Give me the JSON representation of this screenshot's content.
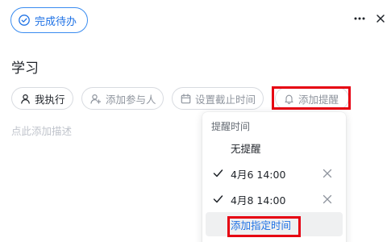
{
  "complete_button": {
    "label": "完成待办",
    "icon": "check-circle-icon"
  },
  "header_icons": {
    "more": "more-horizontal-icon",
    "close": "close-icon"
  },
  "task": {
    "title": "学习",
    "description_placeholder": "点此添加描述"
  },
  "chips": {
    "executor": {
      "label": "我执行",
      "icon": "user-icon"
    },
    "participants": {
      "label": "添加参与人",
      "icon": "add-user-icon"
    },
    "deadline": {
      "label": "设置截止时间",
      "icon": "calendar-icon"
    },
    "reminder": {
      "label": "添加提醒",
      "icon": "bell-icon"
    }
  },
  "reminder_menu": {
    "header": "提醒时间",
    "items": [
      {
        "label": "无提醒",
        "checked": false,
        "removable": false
      },
      {
        "label": "4月6 14:00",
        "checked": true,
        "removable": true
      },
      {
        "label": "4月8 14:00",
        "checked": true,
        "removable": true
      }
    ],
    "add_custom": "添加指定时间"
  },
  "colors": {
    "accent": "#1f72e5",
    "highlight": "#e60012",
    "border": "#d8dbe0",
    "muted_text": "#8f959e"
  }
}
